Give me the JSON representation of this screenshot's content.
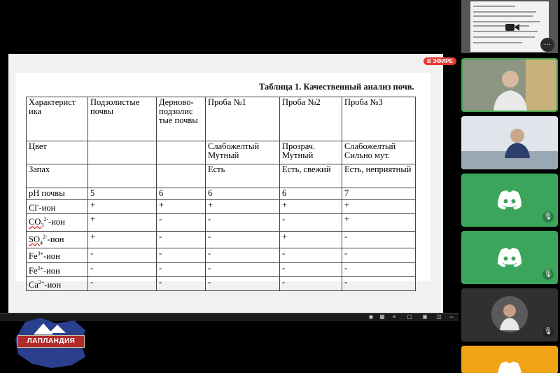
{
  "live_badge": "В ЭФИРЕ",
  "slide": {
    "title": "Таблица 1. Качественный анализ почв."
  },
  "table": {
    "rows": [
      [
        "Характерист ика",
        "Подзолистые почвы",
        "Дерново-подзолис тые почвы",
        "Проба №1",
        "Проба №2",
        "Проба №3"
      ],
      [
        "Цвет",
        "",
        "",
        "Слабожелтый Мутный",
        "Прозрач. Мутный",
        "Слабожелтый Сильно мут."
      ],
      [
        "Запах",
        "",
        "",
        "Есть",
        "Есть, свежий",
        "Есть, неприятный"
      ],
      [
        "pH почвы",
        "5",
        "6",
        "6",
        "6",
        "7"
      ],
      [
        "-ион",
        "+",
        "+",
        "+",
        "+",
        "+"
      ],
      [
        "-ион",
        "+",
        "-",
        "-",
        "-",
        "+"
      ],
      [
        "-ион",
        "+",
        "-",
        "-",
        "+",
        "-"
      ],
      [
        "-ион",
        "-",
        "-",
        "-",
        "-",
        "-"
      ],
      [
        "-ион",
        "-",
        "-",
        "-",
        "-",
        "-"
      ],
      [
        "-ион",
        "-",
        "-",
        "-",
        "-",
        "-"
      ]
    ],
    "ions": [
      {
        "base": "Cl",
        "sup": "-",
        "sub": ""
      },
      {
        "base": "CO",
        "sub": "3",
        "sup": "2-"
      },
      {
        "base": "SO",
        "sub": "4",
        "sup": "2-"
      },
      {
        "base": "Fe",
        "sub": "",
        "sup": "3+"
      },
      {
        "base": "Fe",
        "sub": "",
        "sup": "2+"
      },
      {
        "base": "Ca",
        "sub": "",
        "sup": "2+"
      }
    ]
  },
  "logo": {
    "text": "ЛАПЛАНДИЯ"
  },
  "icons": {
    "toolbar": [
      "record-icon",
      "grid-icon",
      "list-icon",
      "fullscreen-icon",
      "layout-icon",
      "split-icon",
      "expand-icon"
    ],
    "participant_mic": "mic-off-icon",
    "discord": "discord-icon"
  },
  "colors": {
    "discord_green": "#3ba55c",
    "discord_orange": "#f0a313",
    "live_red": "#e53935",
    "active_speaker": "#3fa34d"
  }
}
